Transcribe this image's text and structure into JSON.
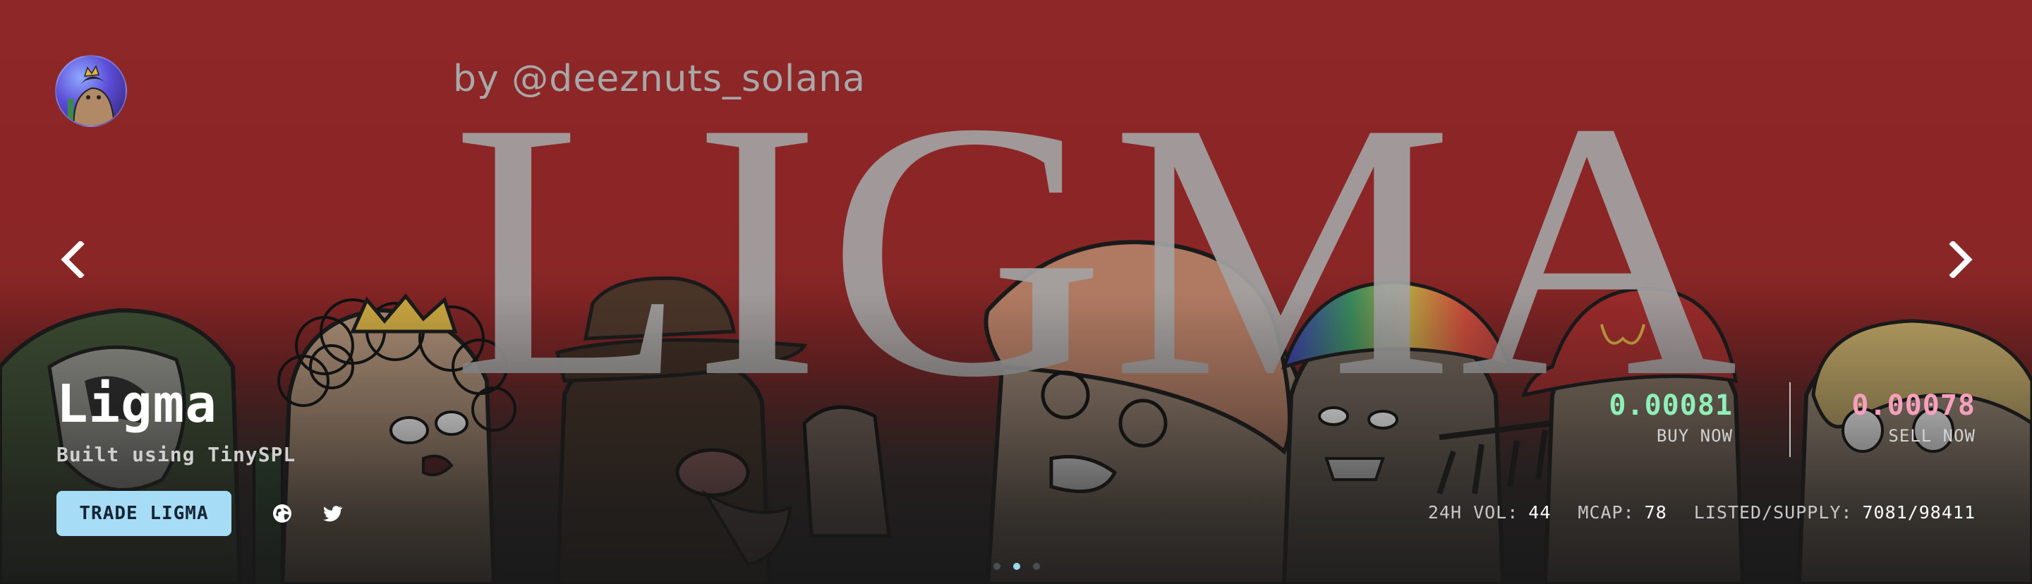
{
  "banner": {
    "byline": "by @deeznuts_solana",
    "big_title": "LIGMA"
  },
  "collection": {
    "name": "Ligma",
    "built_using": "Built using TinySPL",
    "trade_label": "TRADE LIGMA"
  },
  "prices": {
    "buy_value": "0.00081",
    "buy_label": "BUY NOW",
    "sell_value": "0.00078",
    "sell_label": "SELL NOW"
  },
  "stats": {
    "vol_label": "24H VOL:",
    "vol_value": "44",
    "mcap_label": "MCAP:",
    "mcap_value": "78",
    "listed_label": "LISTED/SUPPLY:",
    "listed_value": "7081/98411"
  },
  "icons": {
    "prev": "chevron-left-icon",
    "next": "chevron-right-icon",
    "website": "globe-icon",
    "twitter": "twitter-icon"
  },
  "colors": {
    "background": "#8d2626",
    "trade_button": "#a6dcf5",
    "buy_price": "#8ef0b8",
    "sell_price": "#f7a0be",
    "active_dot": "#9bd8f2"
  },
  "carousel": {
    "slide_count": 3,
    "active_index": 1
  }
}
